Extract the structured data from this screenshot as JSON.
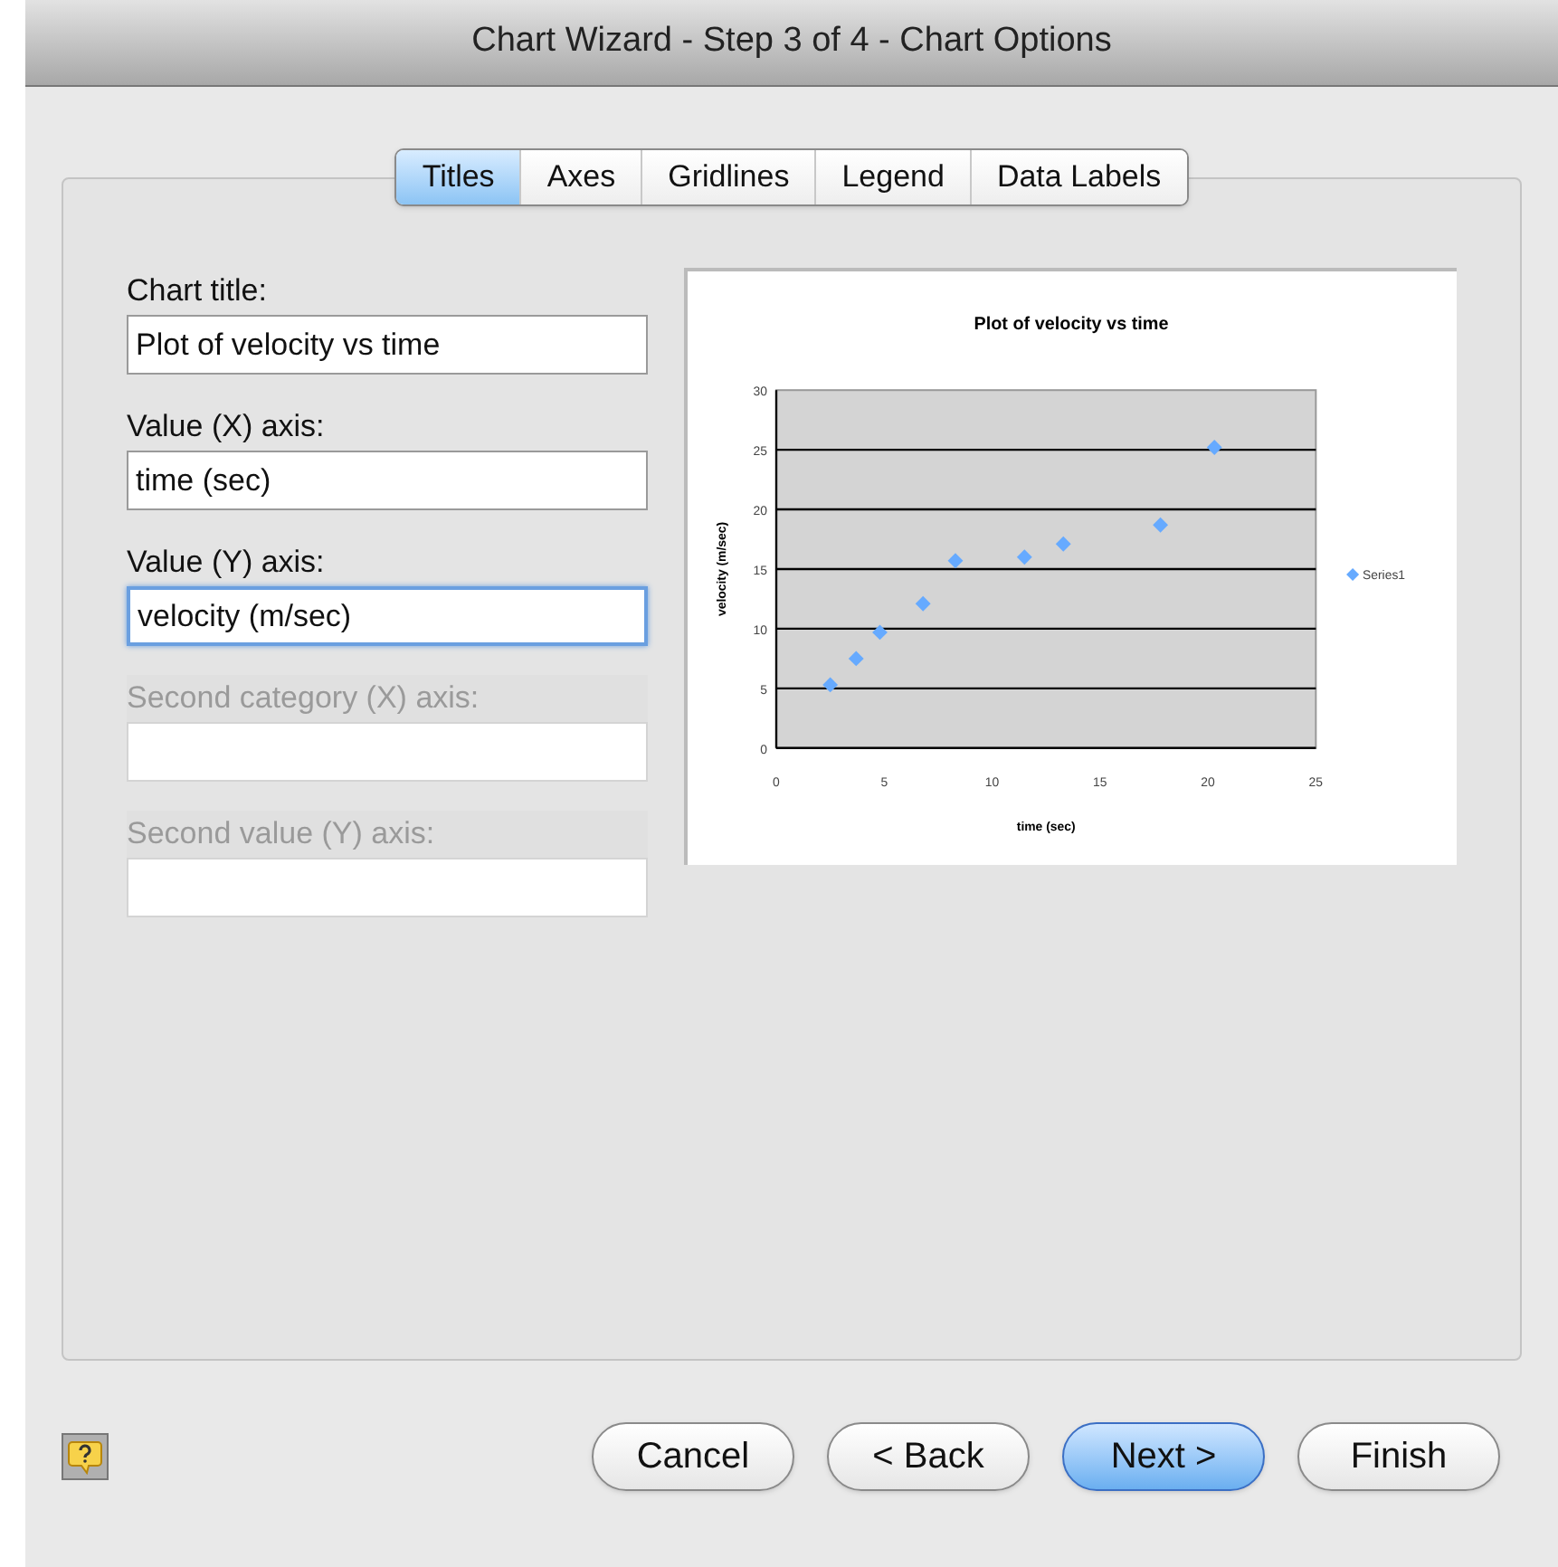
{
  "window": {
    "title": "Chart Wizard - Step 3 of 4 - Chart Options"
  },
  "tabs": [
    {
      "label": "Titles",
      "selected": true
    },
    {
      "label": "Axes",
      "selected": false
    },
    {
      "label": "Gridlines",
      "selected": false
    },
    {
      "label": "Legend",
      "selected": false
    },
    {
      "label": "Data Labels",
      "selected": false
    }
  ],
  "fields": [
    {
      "label": "Chart title:",
      "value": "Plot of velocity vs time",
      "disabled": false,
      "focused": false
    },
    {
      "label": "Value (X) axis:",
      "value": "time (sec)",
      "disabled": false,
      "focused": false
    },
    {
      "label": "Value (Y) axis:",
      "value": "velocity (m/sec)",
      "disabled": false,
      "focused": true
    },
    {
      "label": "Second category (X) axis:",
      "disabled": true,
      "focused": false
    },
    {
      "label": "Second value (Y) axis:",
      "disabled": true,
      "focused": false
    }
  ],
  "preview": {
    "chart_data": {
      "type": "scatter",
      "grid": true,
      "title": "Plot of velocity vs time",
      "xlabel": "time (sec)",
      "ylabel": "velocity (m/sec)",
      "xlim": [
        0,
        25
      ],
      "ylim": [
        0,
        30
      ],
      "xticks": [
        0,
        5,
        10,
        15,
        20,
        25
      ],
      "yticks": [
        0,
        5,
        10,
        15,
        20,
        25,
        30
      ],
      "x": [
        2.5,
        3.7,
        4.8,
        6.8,
        8.3,
        11.5,
        13.3,
        17.8,
        20.3
      ],
      "series": [
        {
          "name": "Series1",
          "color": "#66aaff",
          "values": [
            5.3,
            7.5,
            9.7,
            12.1,
            15.7,
            16,
            17.1,
            18.7,
            25.2
          ]
        }
      ]
    }
  },
  "buttons": [
    {
      "label": "Cancel",
      "default": false
    },
    {
      "label": "< Back",
      "default": false
    },
    {
      "label": "Next >",
      "default": true
    },
    {
      "label": "Finish",
      "default": false
    }
  ]
}
